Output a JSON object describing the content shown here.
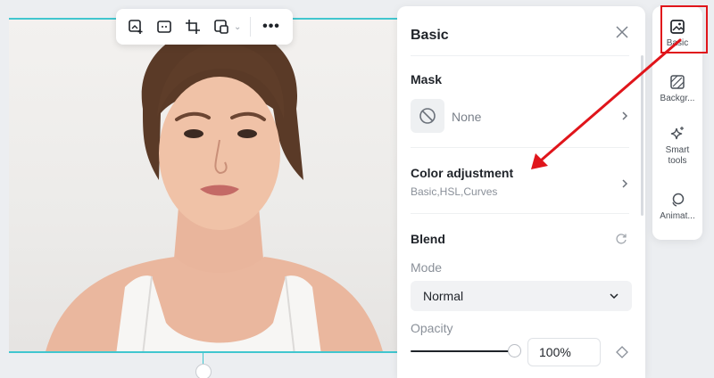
{
  "panel": {
    "title": "Basic",
    "mask": {
      "title": "Mask",
      "value": "None"
    },
    "color_adjustment": {
      "title": "Color adjustment",
      "subtitle": "Basic,HSL,Curves"
    },
    "blend": {
      "title": "Blend",
      "mode_label": "Mode",
      "mode_value": "Normal",
      "opacity_label": "Opacity",
      "opacity_value": "100%",
      "opacity_level": 1.0
    }
  },
  "sidebar": {
    "items": [
      {
        "label": "Basic",
        "icon": "image-icon",
        "active": true
      },
      {
        "label": "Backgr...",
        "icon": "background-icon"
      },
      {
        "label": "Smart tools",
        "icon": "sparkle-icon"
      },
      {
        "label": "Animat...",
        "icon": "animation-icon"
      }
    ]
  },
  "toolbar": {
    "items": [
      "add-image-icon",
      "fit-icon",
      "crop-icon",
      "replace-icon",
      "more-icon"
    ]
  },
  "colors": {
    "selection": "#41c6cf",
    "annotation": "#e0151b",
    "panel_bg": "#ffffff",
    "canvas_bg": "#eceef1"
  }
}
